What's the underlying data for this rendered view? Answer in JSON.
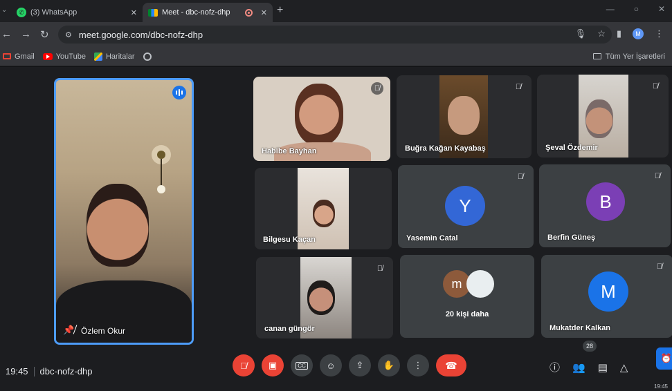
{
  "browser": {
    "tabs": [
      {
        "label": "(3) WhatsApp",
        "icon": "whatsapp-icon",
        "badge": "3"
      },
      {
        "label": "Meet - dbc-nofz-dhp",
        "icon": "google-meet-icon"
      }
    ],
    "url": "meet.google.com/dbc-nofz-dhp",
    "bookmarks": [
      {
        "label": "Gmail",
        "icon": "gmail-icon"
      },
      {
        "label": "YouTube",
        "icon": "youtube-icon"
      },
      {
        "label": "Haritalar",
        "icon": "maps-icon"
      }
    ],
    "all_bookmarks_label": "Tüm Yer İşaretleri",
    "profile_initial": "M"
  },
  "meet": {
    "main_speaker": {
      "name": "Özlem Okur"
    },
    "participants": [
      {
        "name": "Habibe Bayhan",
        "muted": true
      },
      {
        "name": "Buğra Kağan Kayabaş",
        "muted": true
      },
      {
        "name": "Şeval Özdemir",
        "muted": true
      },
      {
        "name": "Bilgesu Kaçan",
        "muted": false
      },
      {
        "name": "Yasemin Catal",
        "muted": true,
        "initial": "Y",
        "color": "#3367d6"
      },
      {
        "name": "Berfin Güneş",
        "muted": true,
        "initial": "B",
        "color": "#7b3fb5"
      },
      {
        "name": "canan güngör",
        "muted": true
      },
      {
        "name": "Mukatder Kalkan",
        "muted": true,
        "initial": "M",
        "color": "#1a73e8"
      }
    ],
    "more_tile": {
      "label": "20 kişi daha",
      "initial": "m",
      "color": "#8d5a3b"
    },
    "time": "19:45",
    "meeting_code": "dbc-nofz-dhp",
    "participant_count": "28",
    "taskbar_time": "19:45"
  }
}
